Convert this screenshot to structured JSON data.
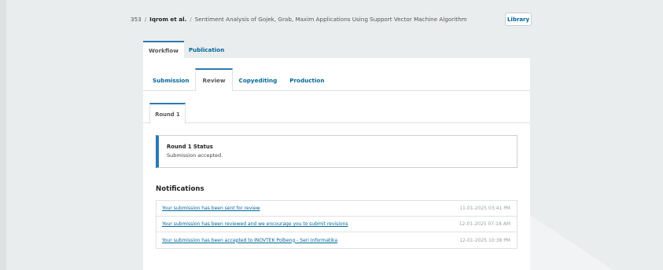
{
  "breadcrumb": {
    "id": "353",
    "author": "Iqrom et al.",
    "title": "Sentiment Analysis of Gojek, Grab, Maxim Applications Using Support Vector Machine Algorithm",
    "separator": "/"
  },
  "header": {
    "library_label": "Library"
  },
  "main_tabs": [
    {
      "label": "Workflow",
      "active": true
    },
    {
      "label": "Publication",
      "active": false
    }
  ],
  "stage_tabs": [
    {
      "label": "Submission",
      "active": false
    },
    {
      "label": "Review",
      "active": true
    },
    {
      "label": "Copyediting",
      "active": false
    },
    {
      "label": "Production",
      "active": false
    }
  ],
  "round_tabs": [
    {
      "label": "Round 1",
      "active": true
    }
  ],
  "round_status": {
    "title": "Round 1 Status",
    "message": "Submission accepted."
  },
  "notifications": {
    "heading": "Notifications",
    "items": [
      {
        "text": "Your submission has been sent for review",
        "date": "11-01-2025 03:41 PM"
      },
      {
        "text": "Your submission has been reviewed and we encourage you to submit revisions",
        "date": "12-01-2025 07:18 AM"
      },
      {
        "text": "Your submission has been accepted to INOVTEK Polbeng - Seri Informatika",
        "date": "12-01-2025 10:38 PM"
      }
    ]
  },
  "colors": {
    "background": "#eaedee",
    "accent": "#2b7ab2",
    "link": "#006798",
    "panel": "#ffffff"
  }
}
